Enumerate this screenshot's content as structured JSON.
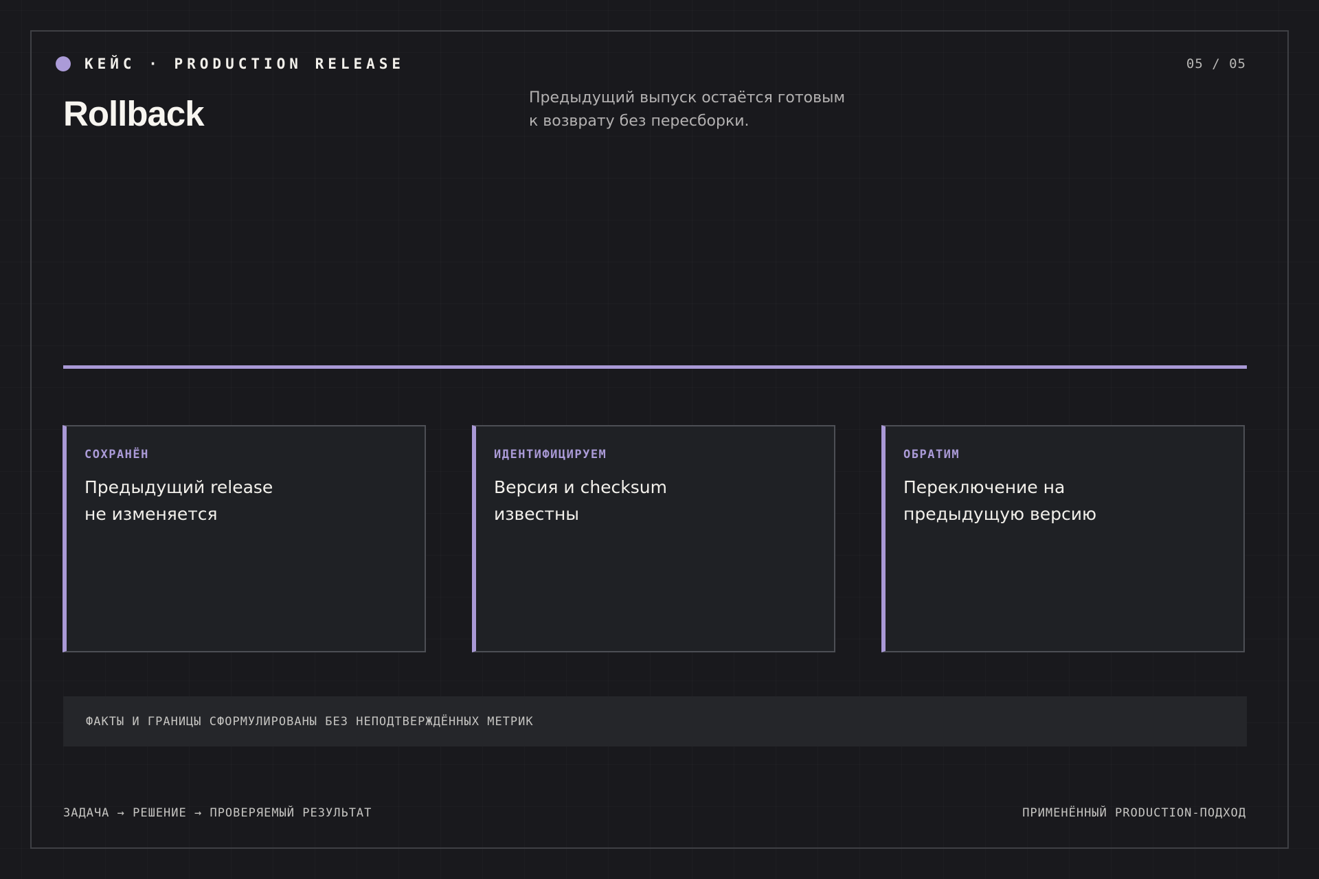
{
  "header": {
    "eyebrow": "КЕЙС · PRODUCTION RELEASE",
    "page_number": "05 / 05"
  },
  "slide": {
    "title": "Rollback",
    "subtitle_lines": [
      "Предыдущий выпуск остаётся готовым",
      "к возврату без пересборки."
    ]
  },
  "cards": [
    {
      "label": "СОХРАНЁН",
      "text_lines": [
        "Предыдущий release",
        "не изменяется"
      ]
    },
    {
      "label": "ИДЕНТИФИЦИРУЕМ",
      "text_lines": [
        "Версия и checksum",
        "известны"
      ]
    },
    {
      "label": "ОБРАТИМ",
      "text_lines": [
        "Переключение на",
        "предыдущую версию"
      ]
    }
  ],
  "note": "ФАКТЫ И ГРАНИЦЫ СФОРМУЛИРОВАНЫ БЕЗ НЕПОДТВЕРЖДЁННЫХ МЕТРИК",
  "footer": {
    "left": "ЗАДАЧА → РЕШЕНИЕ → ПРОВЕРЯЕМЫЙ РЕЗУЛЬТАТ",
    "right": "ПРИМЕНЁННЫЙ PRODUCTION-ПОДХОД"
  },
  "colors": {
    "background": "#19191d",
    "accent": "#a999d6",
    "card_background": "#1f2125",
    "note_background": "#25262a"
  }
}
